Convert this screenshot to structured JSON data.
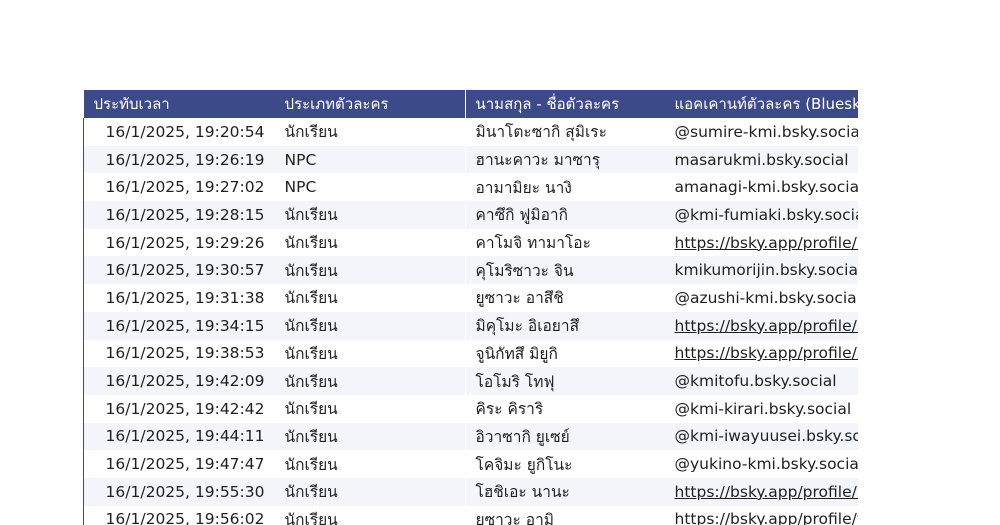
{
  "sheet": {
    "headers": [
      "ประทับเวลา",
      "ประเภทตัวละคร",
      "นามสกุล - ชื่อตัวละคร",
      "แอคเคานท์ตัวละคร (Bluesk"
    ],
    "rows": [
      {
        "timestamp": "16/1/2025, 19:20:54",
        "type": "นักเรียน",
        "name": "มินาโตะซากิ สุมิเระ",
        "account": "@sumire-kmi.bsky.social",
        "is_link": false
      },
      {
        "timestamp": "16/1/2025, 19:26:19",
        "type": "NPC",
        "name": "ฮานะคาวะ มาซารุ",
        "account": "masarukmi.bsky.social",
        "is_link": false
      },
      {
        "timestamp": "16/1/2025, 19:27:02",
        "type": "NPC",
        "name": "อามามิยะ นางิ",
        "account": "amanagi-kmi.bsky.social",
        "is_link": false
      },
      {
        "timestamp": "16/1/2025, 19:28:15",
        "type": "นักเรียน",
        "name": "คาซึกิ ฟูมิอากิ",
        "account": "@kmi-fumiaki.bsky.social",
        "is_link": false
      },
      {
        "timestamp": "16/1/2025, 19:29:26",
        "type": "นักเรียน",
        "name": "คาโมจิ ทามาโอะ",
        "account": "https://bsky.app/profile/k",
        "is_link": true
      },
      {
        "timestamp": "16/1/2025, 19:30:57",
        "type": "นักเรียน",
        "name": "คุโมริซาวะ จิน",
        "account": "kmikumorijin.bsky.social",
        "is_link": false
      },
      {
        "timestamp": "16/1/2025, 19:31:38",
        "type": "นักเรียน",
        "name": "ยูซาวะ อาสึชิ",
        "account": "@azushi-kmi.bsky.social",
        "is_link": false
      },
      {
        "timestamp": "16/1/2025, 19:34:15",
        "type": "นักเรียน",
        "name": "มิคุโมะ อิเอยาสึ",
        "account": "https://bsky.app/profile/k",
        "is_link": true
      },
      {
        "timestamp": "16/1/2025, 19:38:53",
        "type": "นักเรียน",
        "name": "จูนิกัทสึ มิยูกิ",
        "account": "https://bsky.app/profile/k",
        "is_link": true
      },
      {
        "timestamp": "16/1/2025, 19:42:09",
        "type": "นักเรียน",
        "name": "โอโมริ โทฟุ",
        "account": "@kmitofu.bsky.social",
        "is_link": false
      },
      {
        "timestamp": "16/1/2025, 19:42:42",
        "type": "นักเรียน",
        "name": "คิระ คิราริ",
        "account": "@kmi-kirari.bsky.social",
        "is_link": false
      },
      {
        "timestamp": "16/1/2025, 19:44:11",
        "type": "นักเรียน",
        "name": "อิวาซากิ ยูเซย์",
        "account": "@kmi-iwayuusei.bsky.soc",
        "is_link": false
      },
      {
        "timestamp": "16/1/2025, 19:47:47",
        "type": "นักเรียน",
        "name": "โคจิมะ ยูกิโนะ",
        "account": "@yukino-kmi.bsky.social",
        "is_link": false
      },
      {
        "timestamp": "16/1/2025, 19:55:30",
        "type": "นักเรียน",
        "name": "โฮชิเอะ นานะ",
        "account": "https://bsky.app/profile/r",
        "is_link": true
      },
      {
        "timestamp": "16/1/2025, 19:56:02",
        "type": "นักเรียน",
        "name": "ยูซาวะ อามิ",
        "account": "https://bsky.app/profile/y",
        "is_link": true
      }
    ]
  },
  "colors": {
    "header_bg": "#3d4a8a",
    "header_text": "#ffffff",
    "band_row": "#f3f5fb"
  }
}
